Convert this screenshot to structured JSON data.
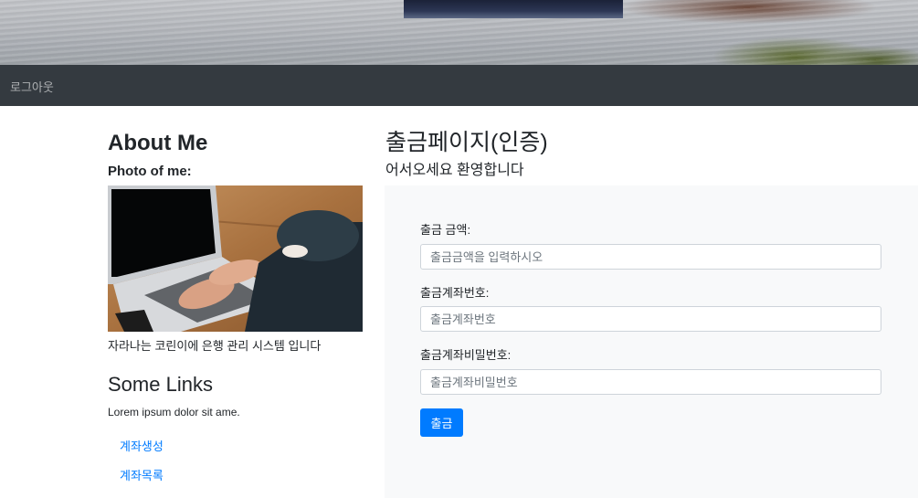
{
  "nav": {
    "logout": "로그아웃"
  },
  "sidebar": {
    "about_title": "About Me",
    "photo_label": "Photo of me:",
    "photo_description": "자라나는 코린이에 은행 관리 시스템 입니다",
    "links_title": "Some Links",
    "links_text": "Lorem ipsum dolor sit ame.",
    "links": [
      {
        "label": "계좌생성"
      },
      {
        "label": "계좌목록"
      }
    ]
  },
  "main": {
    "title": "출금페이지(인증)",
    "subtitle": "어서오세요 환영합니다",
    "form": {
      "amount_label": "출금 금액:",
      "amount_placeholder": "출금금액을 입력하시오",
      "account_label": "출금계좌번호:",
      "account_placeholder": "출금계좌번호",
      "password_label": "출금계좌비밀번호:",
      "password_placeholder": "출금계좌비밀번호",
      "submit_label": "출금"
    }
  },
  "colors": {
    "navbar": "#343a40",
    "link": "#007bff",
    "button": "#007bff",
    "panel": "#f8f9fa"
  },
  "icons": {
    "banner": "coastal-landscape-image",
    "photo": "laptop-typing-photo"
  }
}
